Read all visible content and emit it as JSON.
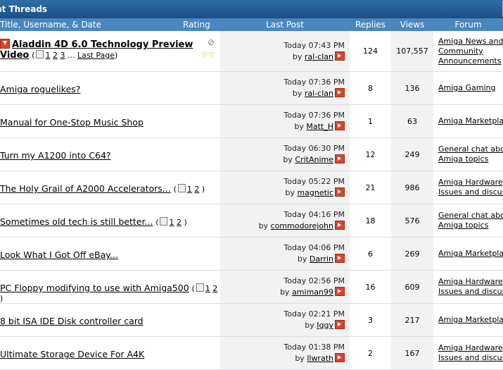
{
  "title_bar": {
    "title": "nt Threads"
  },
  "headers": {
    "title": "Title, Username, & Date",
    "rating": "Rating",
    "last_post": "Last Post",
    "replies": "Replies",
    "views": "Views",
    "forum": "Forum"
  },
  "threads": [
    {
      "title": "Aladdin 4D 6.0 Technology Preview",
      "title_line2": "Video",
      "pages": [
        "1",
        "2",
        "3"
      ],
      "last_page": "Last Page",
      "last_time": "Today 07:43 PM",
      "by": "by",
      "user": "ral-clan",
      "replies": "124",
      "views": "107,557",
      "forum": [
        "Amiga News and",
        "Community",
        "Announcements"
      ],
      "rating": "☆☆"
    },
    {
      "title": "Amiga roguelikes?",
      "last_time": "Today 07:36 PM",
      "by": "by",
      "user": "ral-clan",
      "replies": "8",
      "views": "136",
      "forum": [
        "Amiga Gaming"
      ]
    },
    {
      "title": "Manual for One-Stop Music Shop",
      "last_time": "Today 07:36 PM",
      "by": "by",
      "user": "Matt_H",
      "replies": "1",
      "views": "63",
      "forum": [
        "Amiga Marketpla"
      ]
    },
    {
      "title": "Turn my A1200 into C64?",
      "last_time": "Today 06:30 PM",
      "by": "by",
      "user": "CritAnime",
      "replies": "12",
      "views": "249",
      "forum": [
        "General chat abo",
        "Amiga topics"
      ]
    },
    {
      "title": "The Holy Grail of A2000 Accelerators...",
      "pages": [
        "1",
        "2"
      ],
      "last_time": "Today 05:22 PM",
      "by": "by",
      "user": "magnetic",
      "replies": "21",
      "views": "986",
      "forum": [
        "Amiga Hardware",
        "Issues and discus"
      ]
    },
    {
      "title": "Sometimes old tech is still better...",
      "pages": [
        "1",
        "2"
      ],
      "last_time": "Today 04:16 PM",
      "by": "by",
      "user": "commodorejohn",
      "replies": "18",
      "views": "576",
      "forum": [
        "General chat abo",
        "Amiga topics"
      ]
    },
    {
      "title": "Look What I Got Off eBay...",
      "last_time": "Today 04:06 PM",
      "by": "by",
      "user": "Darrin",
      "replies": "6",
      "views": "269",
      "forum": [
        "Amiga Marketpla"
      ]
    },
    {
      "title": "PC Floppy modifying to use with Amiga500",
      "pages": [
        "1",
        "2"
      ],
      "last_time": "Today 02:56 PM",
      "by": "by",
      "user": "amiman99",
      "replies": "16",
      "views": "609",
      "forum": [
        "Amiga Hardware",
        "Issues and discus"
      ]
    },
    {
      "title": "8 bit ISA IDE Disk controller card",
      "last_time": "Today 02:21 PM",
      "by": "by",
      "user": "Iggy",
      "replies": "3",
      "views": "217",
      "forum": [
        "Amiga Marketpla"
      ]
    },
    {
      "title": "Ultimate Storage Device For A4K",
      "last_time": "Today 01:38 PM",
      "by": "by",
      "user": "llwrath",
      "replies": "2",
      "views": "167",
      "forum": [
        "Amiga Hardware",
        "Issues and discus"
      ]
    }
  ]
}
